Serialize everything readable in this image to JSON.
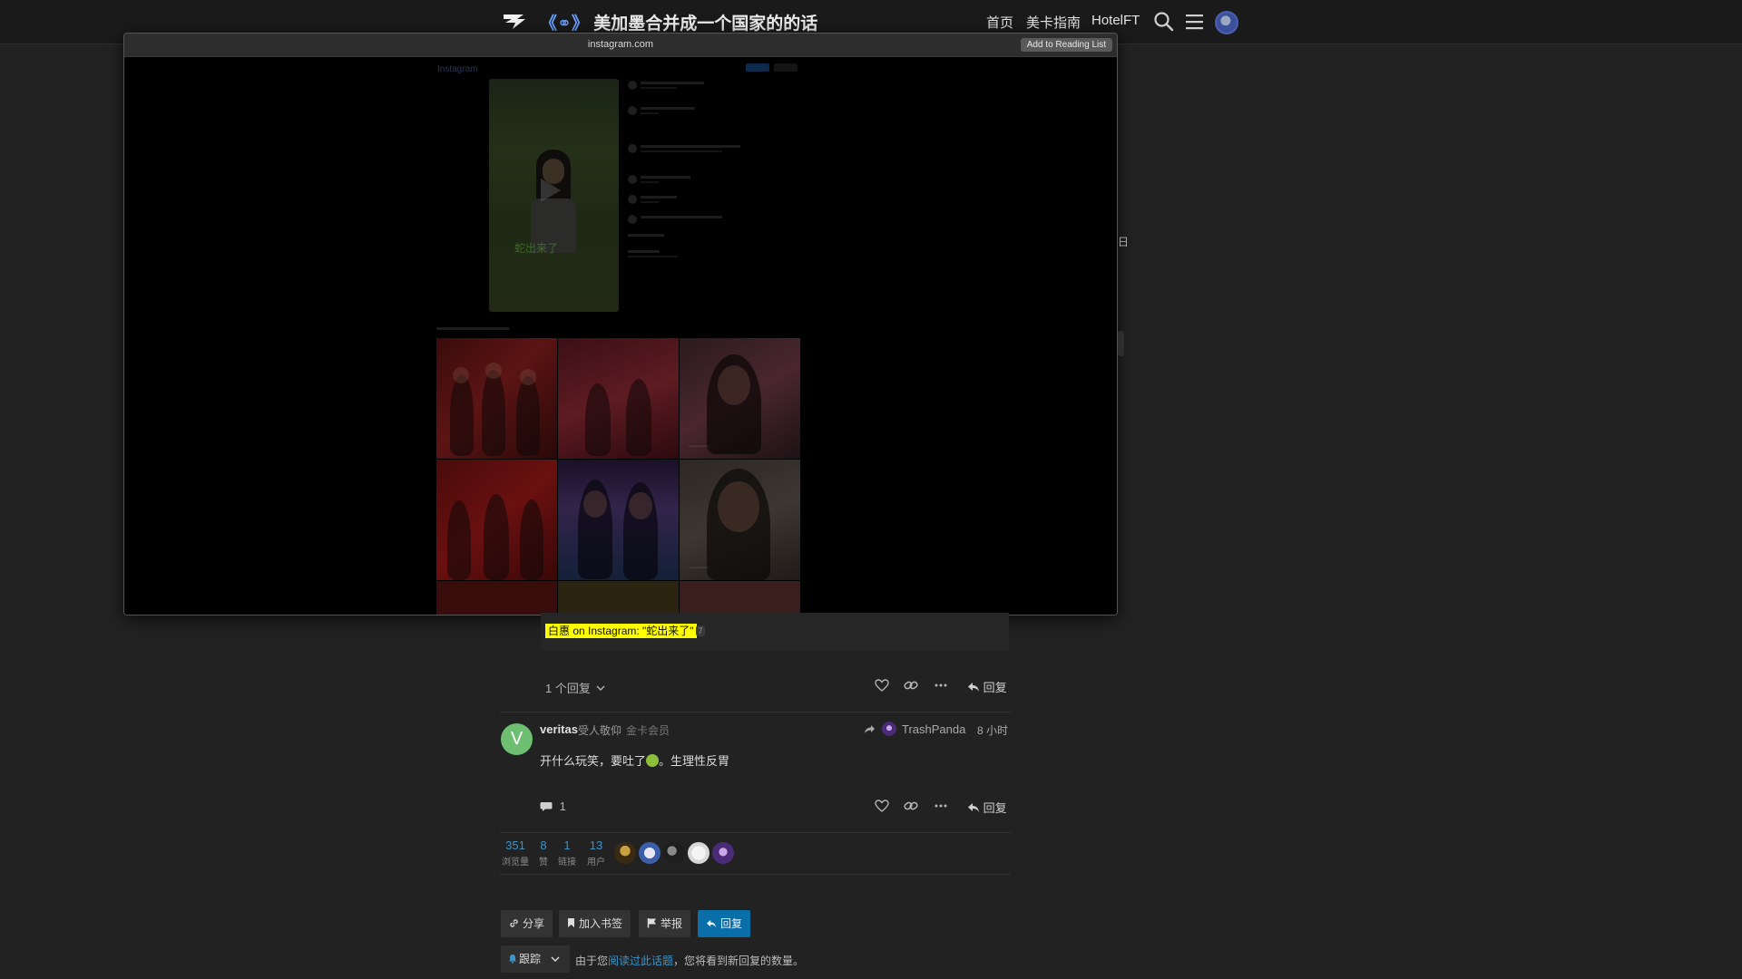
{
  "header": {
    "topic_emoji": "《⚭》",
    "topic_title": "美加墨合并成一个国家的的话",
    "nav": [
      "首页",
      "美卡指南",
      "HotelFT"
    ]
  },
  "popup": {
    "url": "instagram.com",
    "reading_list_label": "Add to Reading List",
    "ig_logo_text": "Instagram",
    "video_caption": "蛇出来了"
  },
  "onebox": {
    "caption": "白惠 on Instagram: \"蛇出来了\"",
    "badge": "7"
  },
  "right_fragment": "日",
  "post1": {
    "replies_toggle": "1 个回复",
    "reply_label": "回复"
  },
  "post2": {
    "avatar_letter": "V",
    "username": "veritas",
    "user_title": "受人敬仰",
    "user_group": "金卡会员",
    "reply_to_user": "TrashPanda",
    "time": "8 小时",
    "body_before": "开什么玩笑，要吐了",
    "body_after": "。生理性反胃",
    "reply_count": "1",
    "reply_label": "回复"
  },
  "stats": [
    {
      "num": "351",
      "label": "浏览量"
    },
    {
      "num": "8",
      "label": "赞"
    },
    {
      "num": "1",
      "label": "链接"
    },
    {
      "num": "13",
      "label": "用户"
    }
  ],
  "footer": {
    "share": "分享",
    "bookmark": "加入书签",
    "flag": "举报",
    "reply": "回复",
    "tracking": "跟踪",
    "note_prefix": "由于您",
    "note_link": "阅读过此话题",
    "note_suffix": "，您将看到新回复的数量。"
  },
  "colors": {
    "accent": "#3d93c8",
    "primary_button": "#0a6fa8",
    "caption_highlight": "#ffff00",
    "avatar_green": "#6fbf73"
  }
}
